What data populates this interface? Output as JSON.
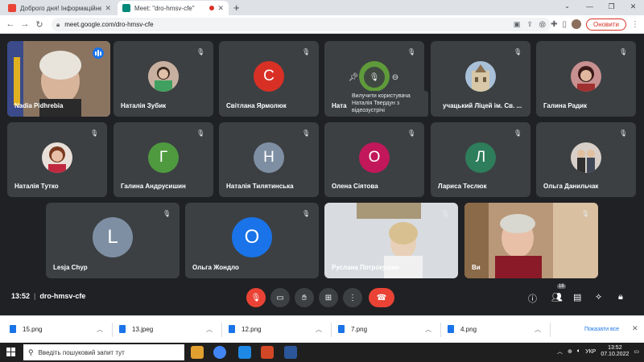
{
  "browser": {
    "tabs": [
      {
        "title": "Доброго дня! Інформаційне пис",
        "active": false
      },
      {
        "title": "Meet: \"dro-hmsv-cfe\"",
        "active": true
      }
    ],
    "url": "meet.google.com/dro-hmsv-cfe",
    "update_label": "Оновити"
  },
  "tiles": [
    {
      "name": "Nadia Pidhrebia",
      "type": "photo",
      "speaking": true
    },
    {
      "name": "Наталія Зубик",
      "type": "photo"
    },
    {
      "name": "Світлана Ярмолюк",
      "type": "letter",
      "letter": "С",
      "color": "#d93025"
    },
    {
      "name": "Ната",
      "type": "letter",
      "letter": "",
      "color": "#5f9b3a"
    },
    {
      "name": "учацький Ліцей ім. Св. ...",
      "type": "photo"
    },
    {
      "name": "Галина Радик",
      "type": "photo"
    },
    {
      "name": "Наталія Тутко",
      "type": "photo"
    },
    {
      "name": "Галина Андрусишин",
      "type": "letter",
      "letter": "Г",
      "color": "#4f9a3f"
    },
    {
      "name": "Наталія Тилятинська",
      "type": "letter",
      "letter": "Н",
      "color": "#7f8fa3"
    },
    {
      "name": "Олена Сіятова",
      "type": "letter",
      "letter": "О",
      "color": "#c2185b"
    },
    {
      "name": "Лариса Теслюк",
      "type": "letter",
      "letter": "Л",
      "color": "#2e7d5b"
    },
    {
      "name": "Ольга Данильчак",
      "type": "photo"
    },
    {
      "name": "Lesja Chyp",
      "type": "letter",
      "letter": "L",
      "color": "#7f8fa3"
    },
    {
      "name": "Ольга Жондло",
      "type": "letter",
      "letter": "О",
      "color": "#1a73e8"
    },
    {
      "name": "Руслана Потрокушин",
      "type": "video"
    },
    {
      "name": "Ви",
      "type": "video"
    }
  ],
  "tooltip": "Вилучити користувача Наталія Твердун з відеозустрічі",
  "meeting": {
    "time": "13:52",
    "code": "dro-hmsv-cfe",
    "participants_count": "16"
  },
  "downloads": [
    {
      "file": "15.png"
    },
    {
      "file": "13.jpeg"
    },
    {
      "file": "12.png"
    },
    {
      "file": "7.png"
    },
    {
      "file": "4.png"
    }
  ],
  "downloads_show_all": "Показати все",
  "taskbar": {
    "search_placeholder": "Введіть пошуковий запит тут",
    "lang": "УКР",
    "time": "13:52",
    "date": "07.10.2022"
  }
}
